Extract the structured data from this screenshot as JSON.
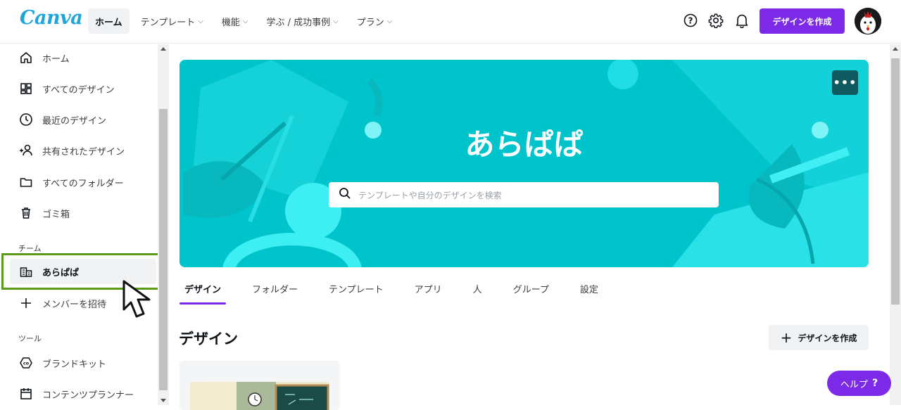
{
  "header": {
    "logo": "Canva",
    "nav": [
      {
        "label": "ホーム",
        "active": true,
        "dropdown": false
      },
      {
        "label": "テンプレート",
        "active": false,
        "dropdown": true
      },
      {
        "label": "機能",
        "active": false,
        "dropdown": true
      },
      {
        "label": "学ぶ / 成功事例",
        "active": false,
        "dropdown": true
      },
      {
        "label": "プラン",
        "active": false,
        "dropdown": true
      }
    ],
    "chevron": "⌵",
    "icons": [
      "help-icon",
      "gear-icon",
      "bell-icon"
    ],
    "create_button": "デザインを作成"
  },
  "sidebar": {
    "items": [
      {
        "label": "ホーム",
        "icon": "home-icon"
      },
      {
        "label": "すべてのデザイン",
        "icon": "grid-icon"
      },
      {
        "label": "最近のデザイン",
        "icon": "clock-icon"
      },
      {
        "label": "共有されたデザイン",
        "icon": "shared-users-icon"
      },
      {
        "label": "すべてのフォルダー",
        "icon": "folder-icon"
      },
      {
        "label": "ゴミ箱",
        "icon": "trash-icon"
      }
    ],
    "team_heading": "チーム",
    "team_items": [
      {
        "label": "あらぱぱ",
        "icon": "team-building-icon",
        "active": true
      },
      {
        "label": "メンバーを招待",
        "icon": "plus-icon",
        "active": false
      }
    ],
    "tools_heading": "ツール",
    "tool_items": [
      {
        "label": "ブランドキット",
        "icon": "brand-kit-icon"
      },
      {
        "label": "コンテンツプランナー",
        "icon": "calendar-icon"
      }
    ]
  },
  "banner": {
    "title": "あらぱぱ",
    "search_placeholder": "テンプレートや自分のデザインを検索",
    "more_label": "•••"
  },
  "tabs": [
    {
      "label": "デザイン",
      "active": true
    },
    {
      "label": "フォルダー",
      "active": false
    },
    {
      "label": "テンプレート",
      "active": false
    },
    {
      "label": "アプリ",
      "active": false
    },
    {
      "label": "人",
      "active": false
    },
    {
      "label": "グループ",
      "active": false
    },
    {
      "label": "設定",
      "active": false
    }
  ],
  "section": {
    "title": "デザイン",
    "create_label": "デザインを作成",
    "create_icon": "+"
  },
  "help": {
    "label": "ヘルプ",
    "icon": "?"
  },
  "colors": {
    "brand_purple": "#7d2ae8",
    "banner_teal": "#00c4cc",
    "highlight_green": "#5a9a1b"
  }
}
